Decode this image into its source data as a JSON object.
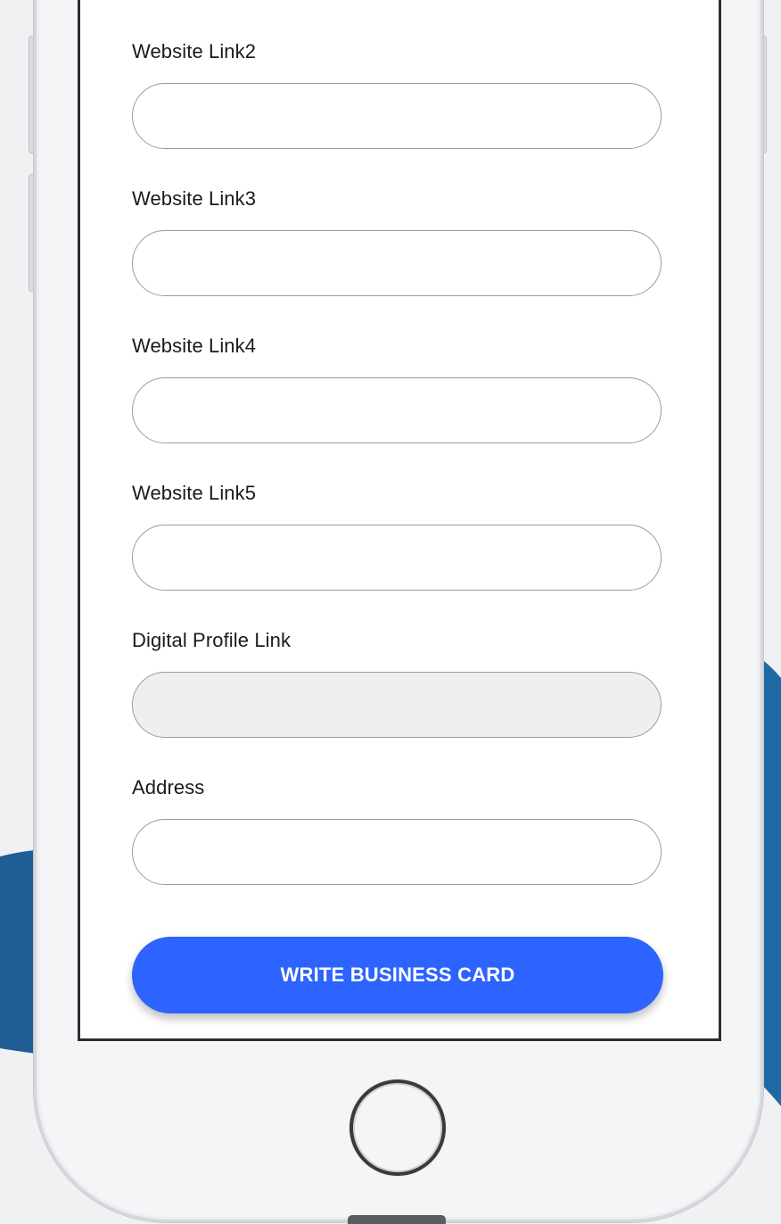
{
  "form": {
    "fields": [
      {
        "label": "Website Link2",
        "value": "",
        "disabled": false
      },
      {
        "label": "Website Link3",
        "value": "",
        "disabled": false
      },
      {
        "label": "Website Link4",
        "value": "",
        "disabled": false
      },
      {
        "label": "Website Link5",
        "value": "",
        "disabled": false
      },
      {
        "label": "Digital Profile Link",
        "value": "",
        "disabled": true
      },
      {
        "label": "Address",
        "value": "",
        "disabled": false
      }
    ],
    "submit_label": "WRITE BUSINESS CARD"
  },
  "colors": {
    "accent": "#2d63ff",
    "background_wave": "#1f5e95",
    "disabled_field": "#efefef"
  },
  "icons": {
    "home_button": "home-button-icon"
  }
}
